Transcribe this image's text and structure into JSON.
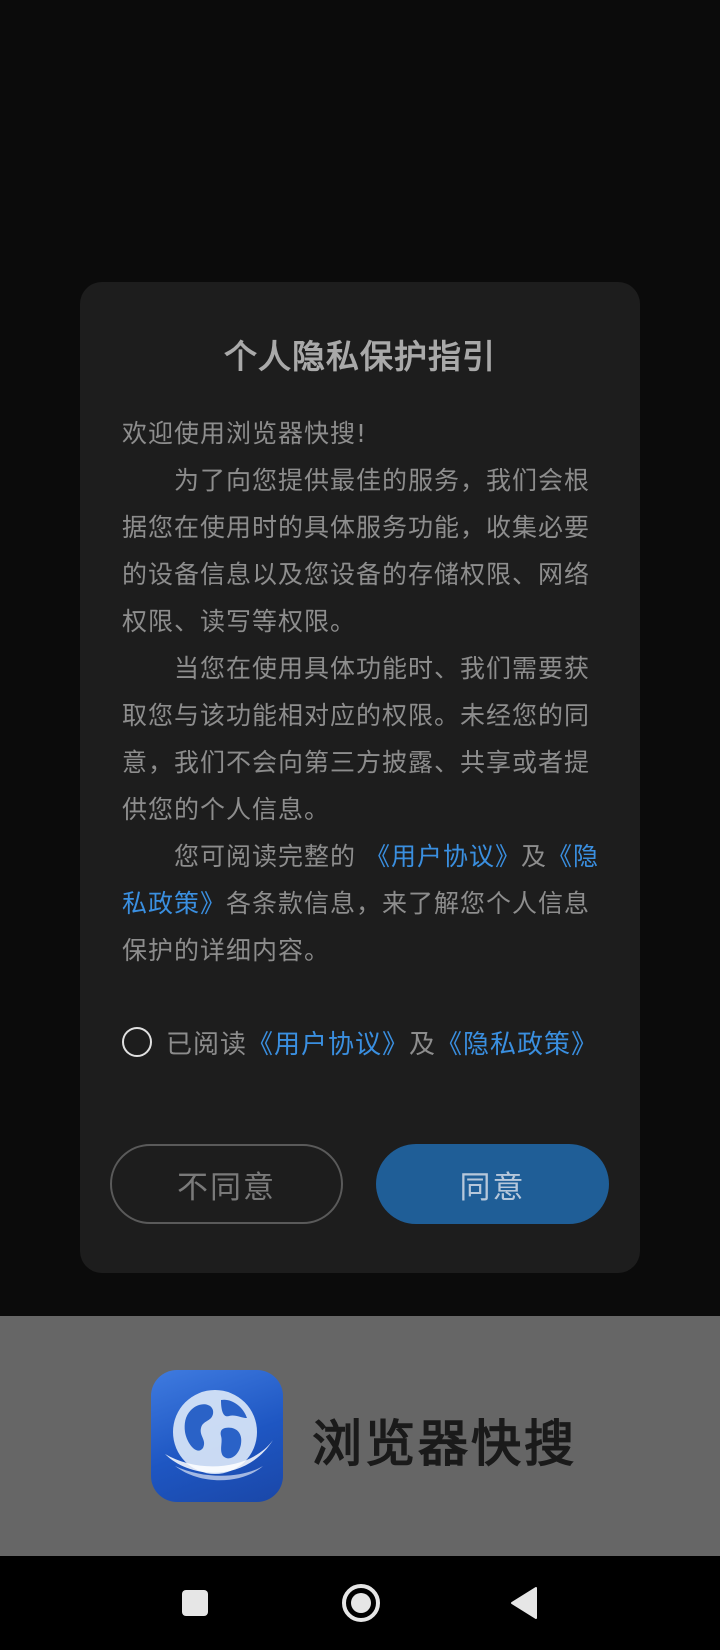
{
  "dialog": {
    "title": "个人隐私保护指引",
    "welcome": "欢迎使用浏览器快搜!",
    "paragraph1": "为了向您提供最佳的服务，我们会根据您在使用时的具体服务功能，收集必要的设备信息以及您设备的存储权限、网络权限、读写等权限。",
    "paragraph2": "当您在使用具体功能时、我们需要获取您与该功能相对应的权限。未经您的同意，我们不会向第三方披露、共享或者提供您的个人信息。",
    "paragraph3_prefix": "您可阅读完整的",
    "user_agreement_link": "《用户协议》",
    "and_text": "及",
    "privacy_policy_link": "《隐私政策》",
    "paragraph3_suffix": "各条款信息，来了解您个人信息保护的详细内容。",
    "consent_prefix": "已阅读",
    "consent_user_agreement": "《用户协议》",
    "consent_and": "及",
    "consent_privacy_policy": "《隐私政策》",
    "consent_checked": false,
    "disagree_label": "不同意",
    "agree_label": "同意"
  },
  "splash": {
    "app_name": "浏览器快搜",
    "app_icon": "globe-icon"
  },
  "nav_bar": {
    "recents_icon": "square-icon",
    "home_icon": "circle-icon",
    "back_icon": "triangle-back-icon"
  },
  "colors": {
    "link": "#3a8fe0",
    "agree_button": "#1f5e97",
    "dialog_bg": "#1d1d1d",
    "splash_bg": "#666666"
  }
}
